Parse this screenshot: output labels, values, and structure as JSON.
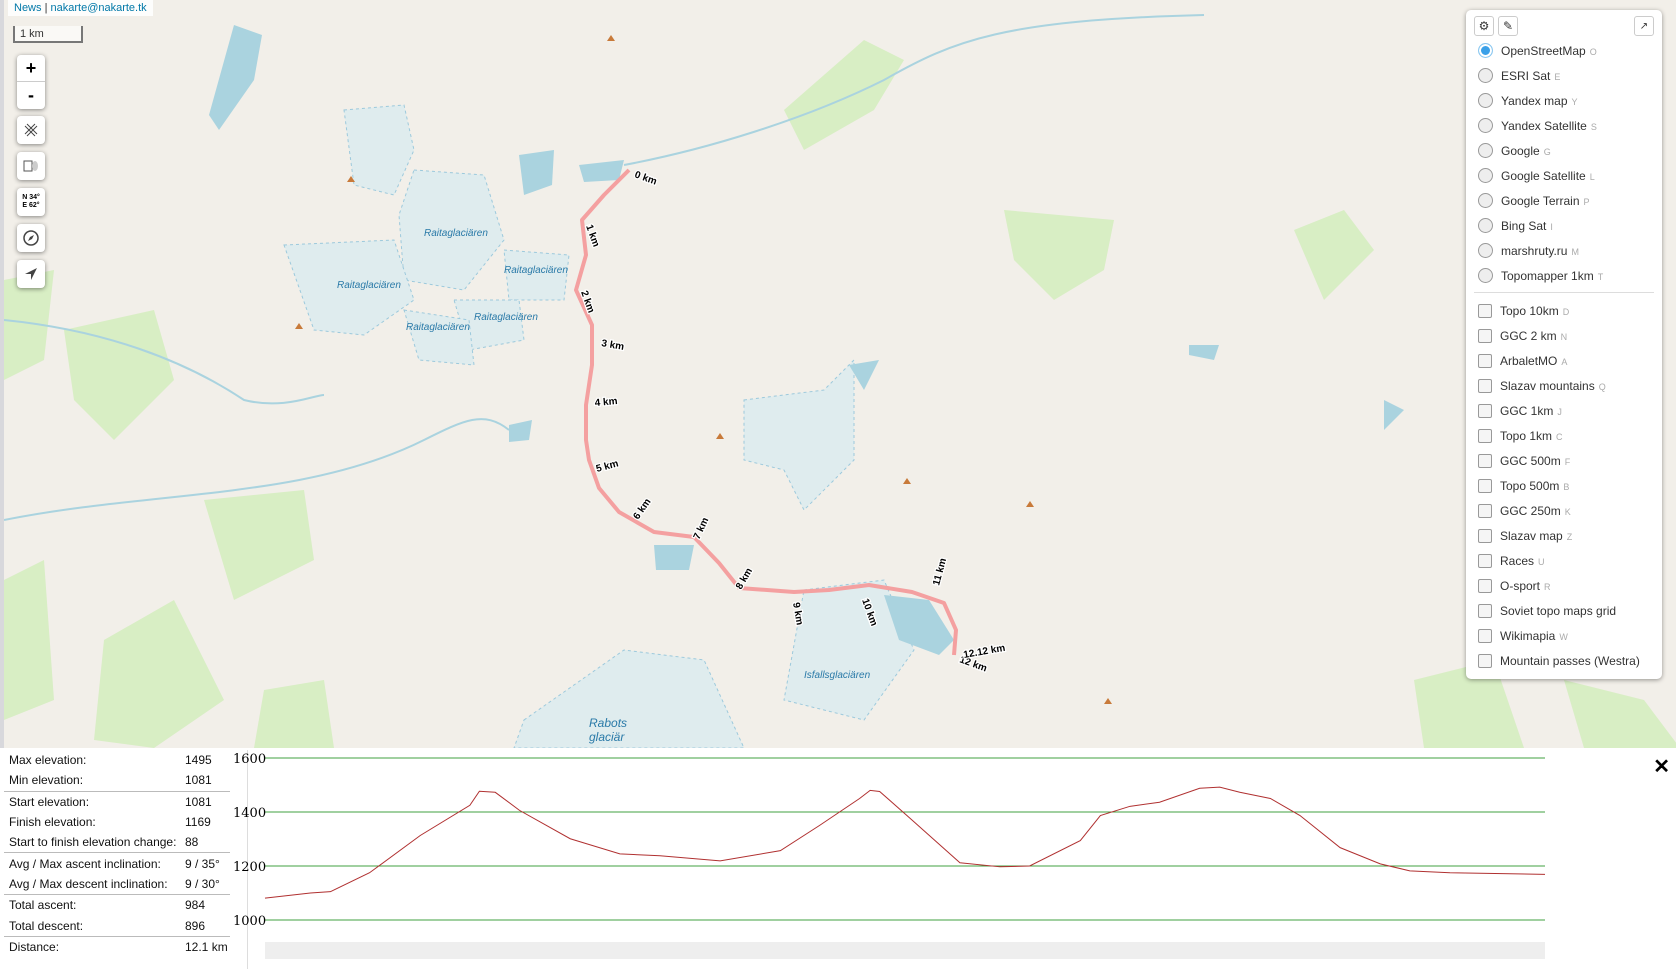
{
  "links": {
    "news": "News",
    "sep": "|",
    "email": "nakarte@nakarte.tk"
  },
  "scale": "1 km",
  "controls": {
    "zoom_in": "+",
    "zoom_out": "-",
    "coords": [
      "N 34°",
      "E 62°"
    ]
  },
  "map_labels": {
    "glaciers": [
      "Raitaglaciären",
      "Raitaglaciären",
      "Raitaglaciären",
      "Raitaglaciären",
      "Raitaglaciären",
      "Isfallsglaciären"
    ],
    "rabots": [
      "Rabots",
      "glaciär"
    ]
  },
  "route": {
    "color": "#f4a0a0",
    "km_labels": [
      "0 km",
      "1 km",
      "2 km",
      "3 km",
      "4 km",
      "5 km",
      "6 km",
      "7 km",
      "8 km",
      "9 km",
      "10 km",
      "11 km",
      "12 km",
      "12.12 km"
    ]
  },
  "layers": {
    "base": [
      {
        "label": "OpenStreetMap",
        "key": "O",
        "selected": true
      },
      {
        "label": "ESRI Sat",
        "key": "E"
      },
      {
        "label": "Yandex map",
        "key": "Y"
      },
      {
        "label": "Yandex Satellite",
        "key": "S"
      },
      {
        "label": "Google",
        "key": "G"
      },
      {
        "label": "Google Satellite",
        "key": "L"
      },
      {
        "label": "Google Terrain",
        "key": "P"
      },
      {
        "label": "Bing Sat",
        "key": "I"
      },
      {
        "label": "marshruty.ru",
        "key": "M"
      },
      {
        "label": "Topomapper 1km",
        "key": "T"
      }
    ],
    "overlays": [
      {
        "label": "Topo 10km",
        "key": "D"
      },
      {
        "label": "GGC 2 km",
        "key": "N"
      },
      {
        "label": "ArbaletMO",
        "key": "A"
      },
      {
        "label": "Slazav mountains",
        "key": "Q"
      },
      {
        "label": "GGC 1km",
        "key": "J"
      },
      {
        "label": "Topo 1km",
        "key": "C"
      },
      {
        "label": "GGC 500m",
        "key": "F"
      },
      {
        "label": "Topo 500m",
        "key": "B"
      },
      {
        "label": "GGC 250m",
        "key": "K"
      },
      {
        "label": "Slazav map",
        "key": "Z"
      },
      {
        "label": "Races",
        "key": "U"
      },
      {
        "label": "O-sport",
        "key": "R"
      },
      {
        "label": "Soviet topo maps grid",
        "key": ""
      },
      {
        "label": "Wikimapia",
        "key": "W"
      },
      {
        "label": "Mountain passes (Westra)",
        "key": ""
      }
    ]
  },
  "stats": [
    {
      "label": "Max elevation:",
      "value": "1495"
    },
    {
      "label": "Min elevation:",
      "value": "1081",
      "sep": true
    },
    {
      "label": "Start elevation:",
      "value": "1081"
    },
    {
      "label": "Finish elevation:",
      "value": "1169"
    },
    {
      "label": "Start to finish elevation change:",
      "value": "88",
      "sep": true
    },
    {
      "label": "Avg / Max ascent inclination:",
      "value": "9 / 35°"
    },
    {
      "label": "Avg / Max descent inclination:",
      "value": "9 / 30°",
      "sep": true
    },
    {
      "label": "Total ascent:",
      "value": "984"
    },
    {
      "label": "Total descent:",
      "value": "896",
      "sep": true
    },
    {
      "label": "Distance:",
      "value": "12.1 km"
    }
  ],
  "close": "✕",
  "chart_data": {
    "type": "line",
    "ylim": [
      1000,
      1600
    ],
    "xlim": [
      0,
      12.12
    ],
    "grid": true,
    "yticks": [
      "1600",
      "1400",
      "1200",
      "1000"
    ],
    "line_color": "#b03030",
    "grid_color": "#40a040",
    "x": [
      0,
      0.43,
      0.62,
      0.99,
      1.47,
      1.94,
      2.03,
      2.18,
      2.41,
      2.89,
      3.36,
      3.74,
      4.31,
      4.88,
      5.25,
      5.63,
      5.73,
      5.82,
      6.11,
      6.58,
      6.96,
      7.24,
      7.72,
      7.91,
      8.19,
      8.47,
      8.85,
      9.04,
      9.23,
      9.52,
      9.8,
      10.18,
      10.56,
      10.84,
      11.22,
      12.12
    ],
    "y": [
      1081,
      1100,
      1105,
      1175,
      1313,
      1425,
      1477,
      1473,
      1406,
      1301,
      1245,
      1238,
      1219,
      1257,
      1350,
      1450,
      1480,
      1476,
      1376,
      1212,
      1197,
      1200,
      1294,
      1387,
      1421,
      1436,
      1488,
      1492,
      1473,
      1450,
      1387,
      1268,
      1208,
      1182,
      1175,
      1169
    ]
  }
}
